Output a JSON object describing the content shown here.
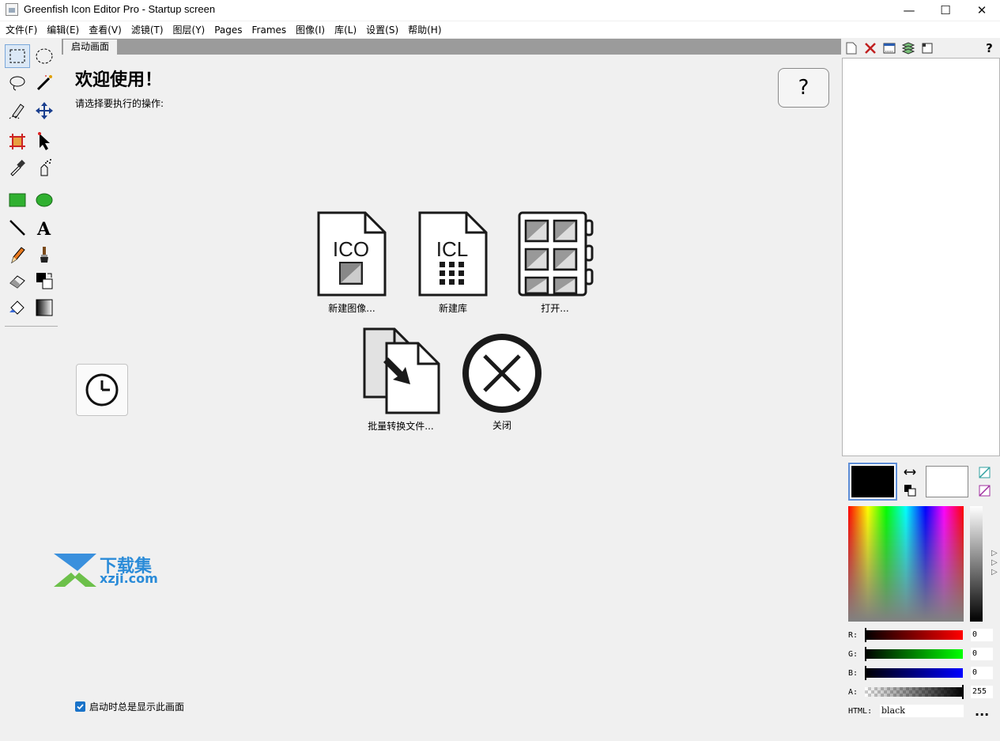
{
  "window": {
    "title": "Greenfish Icon Editor Pro - Startup screen",
    "minimize": "—",
    "maximize": "☐",
    "close": "✕"
  },
  "menu": {
    "items": [
      {
        "label": "文件(F)"
      },
      {
        "label": "编辑(E)"
      },
      {
        "label": "查看(V)"
      },
      {
        "label": "滤镜(T)"
      },
      {
        "label": "图层(Y)"
      },
      {
        "label": "Pages"
      },
      {
        "label": "Frames"
      },
      {
        "label": "图像(I)"
      },
      {
        "label": "库(L)"
      },
      {
        "label": "设置(S)"
      },
      {
        "label": "帮助(H)"
      }
    ]
  },
  "tabs": [
    {
      "label": "启动画面"
    }
  ],
  "startup": {
    "heading": "欢迎使用！",
    "subtitle": "请选择要执行的操作:",
    "help": "?",
    "actions": {
      "new_image": {
        "label": "新建图像...",
        "icon_text": "ICO"
      },
      "new_library": {
        "label": "新建库",
        "icon_text": "ICL"
      },
      "open": {
        "label": "打开..."
      },
      "batch_convert": {
        "label": "批量转换文件..."
      },
      "close": {
        "label": "关闭"
      }
    },
    "show_on_startup": {
      "label": "启动时总是显示此画面",
      "checked": true
    }
  },
  "watermark": {
    "line1": "下载集",
    "line2": "xzji.com"
  },
  "color_panel": {
    "foreground": "#000000",
    "background": "#ffffff",
    "channels": [
      {
        "label": "R:",
        "value": "0",
        "color": "#ff0000"
      },
      {
        "label": "G:",
        "value": "0",
        "color": "#00ff00"
      },
      {
        "label": "B:",
        "value": "0",
        "color": "#0000ff"
      },
      {
        "label": "A:",
        "value": "255",
        "color": "#000000"
      }
    ],
    "html_label": "HTML:",
    "html_value": "black",
    "more": "..."
  },
  "layers_toolbar": {
    "help": "?"
  }
}
